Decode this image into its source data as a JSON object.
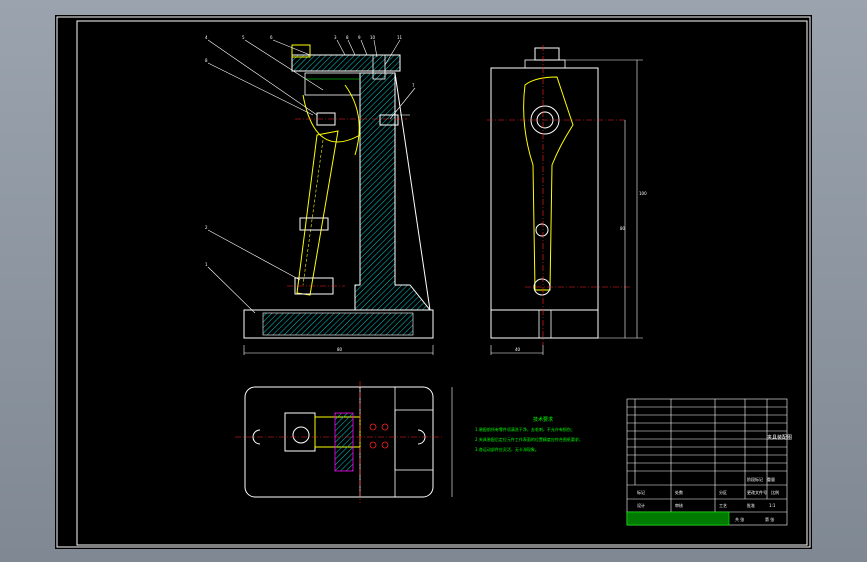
{
  "colors": {
    "background": "#000000",
    "frame": "#ffffff",
    "hatch": "#00c8c8",
    "part": "#ffff00",
    "centerline": "#ff2020",
    "note": "#00ff00",
    "dimension": "#ffffff",
    "leader": "#ffffff"
  },
  "drawing": {
    "balloons": [
      "4",
      "5",
      "6",
      "3",
      "8",
      "9",
      "10",
      "11",
      "8",
      "7",
      "2",
      "1"
    ],
    "dimensions": {
      "front_width": "80",
      "side_width": "40",
      "side_height_1": "100",
      "side_height_2": "80"
    },
    "notes": {
      "title": "技术要求",
      "lines": [
        "1.装配前所有零件须清洗干净，去毛刺，不允许有损伤；",
        "2.夹具装配后定位元件工作表面的位置精度应符合图纸要求；",
        "3.各运动部件应灵活，无卡滞现象。"
      ]
    },
    "title_block": {
      "labels": [
        "标记",
        "处数",
        "分区",
        "更改文件号",
        "签名",
        "年月日",
        "设计",
        "审核",
        "工艺",
        "批准",
        "阶段标记",
        "重量",
        "比例",
        "共 张",
        "第 张"
      ],
      "name": "夹具装配图",
      "scale": "1:1"
    }
  }
}
